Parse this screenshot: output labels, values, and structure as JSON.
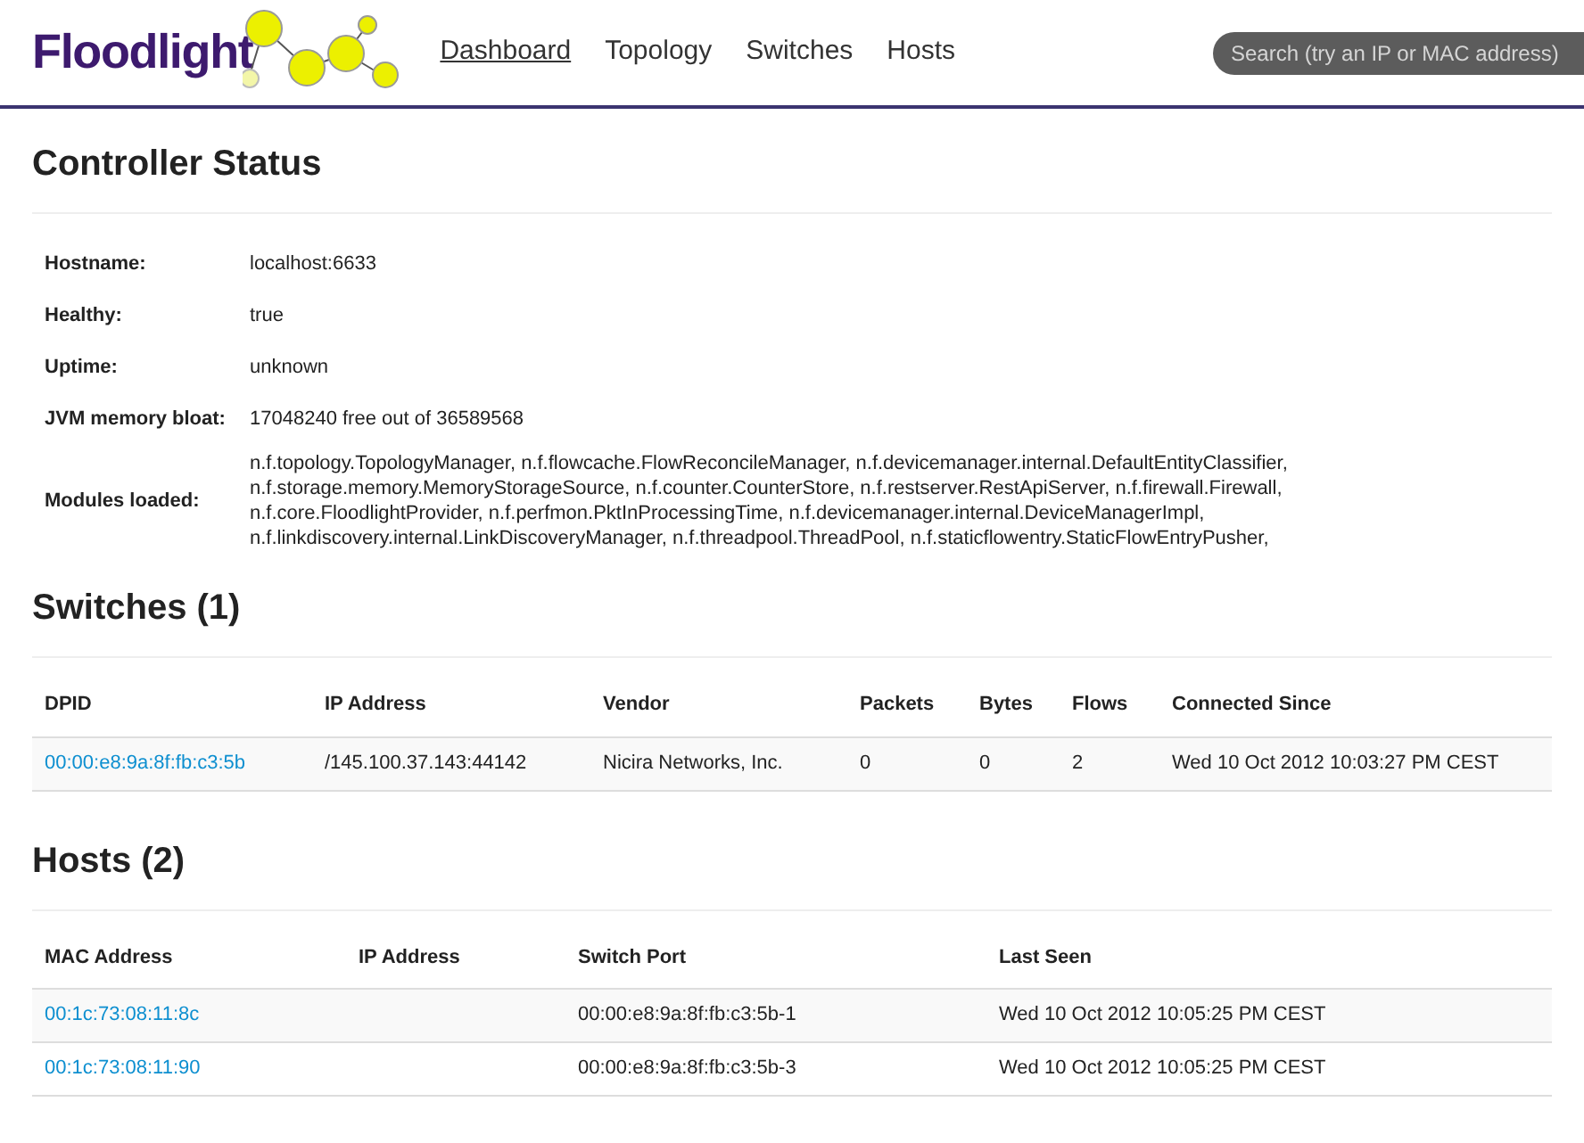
{
  "logo": {
    "text": "Floodlight"
  },
  "nav": [
    {
      "label": "Dashboard",
      "selected": true
    },
    {
      "label": "Topology",
      "selected": false
    },
    {
      "label": "Switches",
      "selected": false
    },
    {
      "label": "Hosts",
      "selected": false
    }
  ],
  "search": {
    "placeholder": "Search (try an IP or MAC address)"
  },
  "controller_status": {
    "title": "Controller Status",
    "rows": [
      {
        "label": "Hostname:",
        "value": "localhost:6633"
      },
      {
        "label": "Healthy:",
        "value": "true"
      },
      {
        "label": "Uptime:",
        "value": "unknown"
      },
      {
        "label": "JVM memory bloat:",
        "value": "17048240 free out of 36589568"
      },
      {
        "label": "Modules loaded:",
        "value": "n.f.topology.TopologyManager, n.f.flowcache.FlowReconcileManager, n.f.devicemanager.internal.DefaultEntityClassifier, n.f.storage.memory.MemoryStorageSource, n.f.counter.CounterStore, n.f.restserver.RestApiServer, n.f.firewall.Firewall, n.f.core.FloodlightProvider, n.f.perfmon.PktInProcessingTime, n.f.devicemanager.internal.DeviceManagerImpl, n.f.linkdiscovery.internal.LinkDiscoveryManager, n.f.threadpool.ThreadPool, n.f.staticflowentry.StaticFlowEntryPusher,"
      }
    ]
  },
  "switches": {
    "title": "Switches (1)",
    "columns": [
      "DPID",
      "IP Address",
      "Vendor",
      "Packets",
      "Bytes",
      "Flows",
      "Connected Since"
    ],
    "rows": [
      [
        "00:00:e8:9a:8f:fb:c3:5b",
        "/145.100.37.143:44142",
        "Nicira Networks, Inc.",
        "0",
        "0",
        "2",
        "Wed 10 Oct 2012 10:03:27 PM CEST"
      ]
    ]
  },
  "hosts": {
    "title": "Hosts (2)",
    "columns": [
      "MAC Address",
      "IP Address",
      "Switch Port",
      "Last Seen"
    ],
    "rows": [
      [
        "00:1c:73:08:11:8c",
        "",
        "00:00:e8:9a:8f:fb:c3:5b-1",
        "Wed 10 Oct 2012 10:05:25 PM CEST"
      ],
      [
        "00:1c:73:08:11:90",
        "",
        "00:00:e8:9a:8f:fb:c3:5b-3",
        "Wed 10 Oct 2012 10:05:25 PM CEST"
      ]
    ]
  }
}
